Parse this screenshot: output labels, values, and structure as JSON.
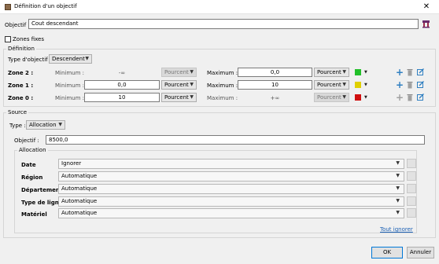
{
  "window": {
    "title": "Définition d'un objectif",
    "close_glyph": "✕"
  },
  "objectif": {
    "label": "Objectif :",
    "value": "Cout descendant"
  },
  "zones_fixes": {
    "label": "Zones fixes",
    "checked": false
  },
  "definition": {
    "legend": "Définition",
    "type_label": "Type d'objectif :",
    "type_value": "Descendent",
    "zones": [
      {
        "label": "Zone 2 :",
        "min_label": "Minimum :",
        "min_value": "-∞",
        "min_unit": "Pourcent",
        "max_label": "Maximum :",
        "max_value": "0,0",
        "max_unit": "Pourcent",
        "color": "#22c02a",
        "can_add": true
      },
      {
        "label": "Zone 1 :",
        "min_label": "Minimum :",
        "min_value": "0,0",
        "min_unit": "Pourcent",
        "max_label": "Maximum :",
        "max_value": "10",
        "max_unit": "Pourcent",
        "color": "#e0d000",
        "can_add": true
      },
      {
        "label": "Zone 0 :",
        "min_label": "Minimum :",
        "min_value": "10",
        "min_unit": "Pourcent",
        "max_label": "Maximum :",
        "max_value": "+∞",
        "max_unit": "Pourcent",
        "color": "#d01010",
        "can_add": false
      }
    ]
  },
  "source": {
    "legend": "Source",
    "type_label": "Type :",
    "type_value": "Allocation",
    "objectif_label": "Objectif :",
    "objectif_value": "8500,0",
    "allocation": {
      "legend": "Allocation",
      "rows": [
        {
          "label": "Date",
          "value": "Ignorer"
        },
        {
          "label": "Région",
          "value": "Automatique"
        },
        {
          "label": "Département",
          "value": "Automatique"
        },
        {
          "label": "Type de ligne",
          "value": "Automatique"
        },
        {
          "label": "Matériel",
          "value": "Automatique"
        }
      ],
      "ignore_all_link": "Tout ignorer"
    }
  },
  "footer": {
    "ok_label": "OK",
    "cancel_label": "Annuler"
  },
  "icons": {
    "dropdown": "▼",
    "plus": "+"
  }
}
